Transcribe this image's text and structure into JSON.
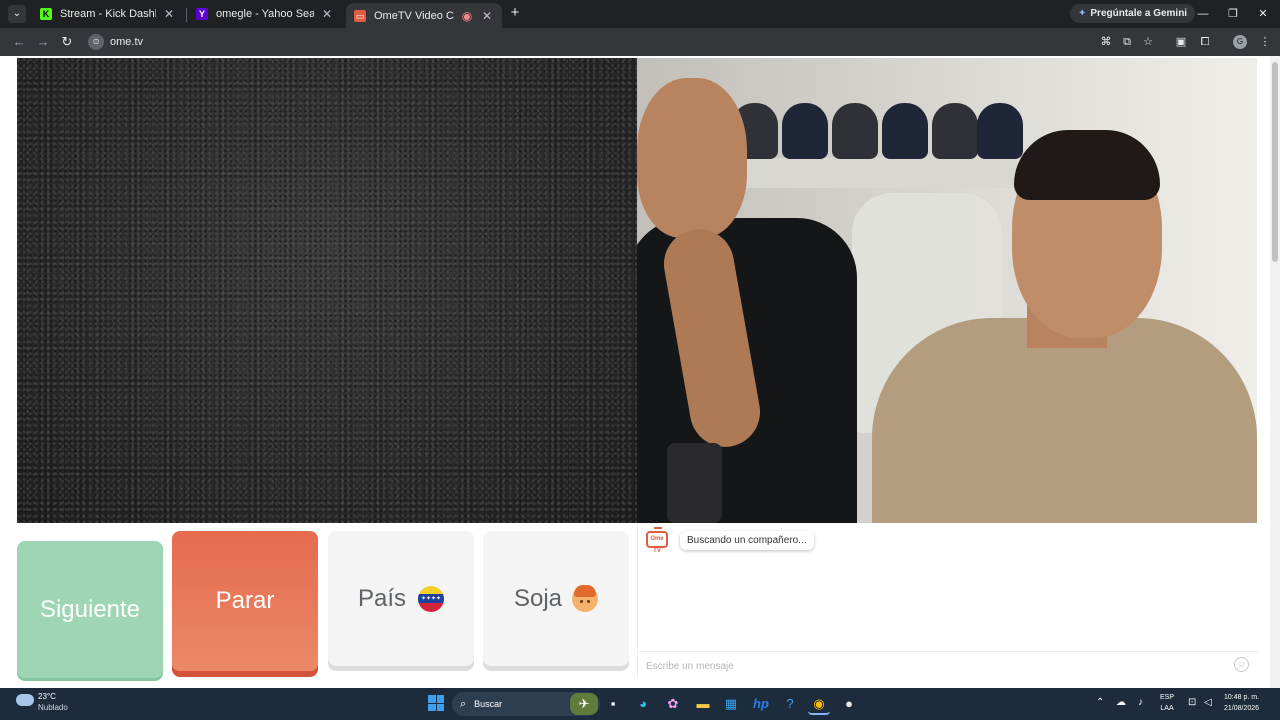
{
  "browser": {
    "tabs": [
      {
        "title": "Stream - Kick Dashboard",
        "favicon": "kick-icon",
        "color": "#53fc18"
      },
      {
        "title": "omegle - Yahoo Search Tus res",
        "favicon": "yahoo-icon",
        "color": "#6001d2"
      },
      {
        "title": "OmeTV Video Chat — Alte",
        "favicon": "ometv-icon",
        "color": "#e25b43"
      }
    ],
    "new_tab": "+",
    "gemini_label": "Pregúntale a Gemini",
    "url": "ome.tv",
    "profile_initial": "G"
  },
  "controls": {
    "next_label": "Siguiente",
    "stop_label": "Parar",
    "country_label": "País",
    "gender_label": "Soja"
  },
  "chat": {
    "logo_text": "Ome TV",
    "status_message": "Buscando un compañero...",
    "input_placeholder": "Escribe un mensaje"
  },
  "taskbar": {
    "weather_temp": "23°C",
    "weather_desc": "Nublado",
    "search_placeholder": "Buscar",
    "lang_line1": "ESP",
    "lang_line2": "LAA",
    "time": "10:48 p. m.",
    "date": "21/08/2026"
  },
  "colors": {
    "next_button": "#9ed6b3",
    "stop_button": "#e56b4e",
    "option_button": "#f4f4f4",
    "brand_accent": "#e25b43"
  }
}
